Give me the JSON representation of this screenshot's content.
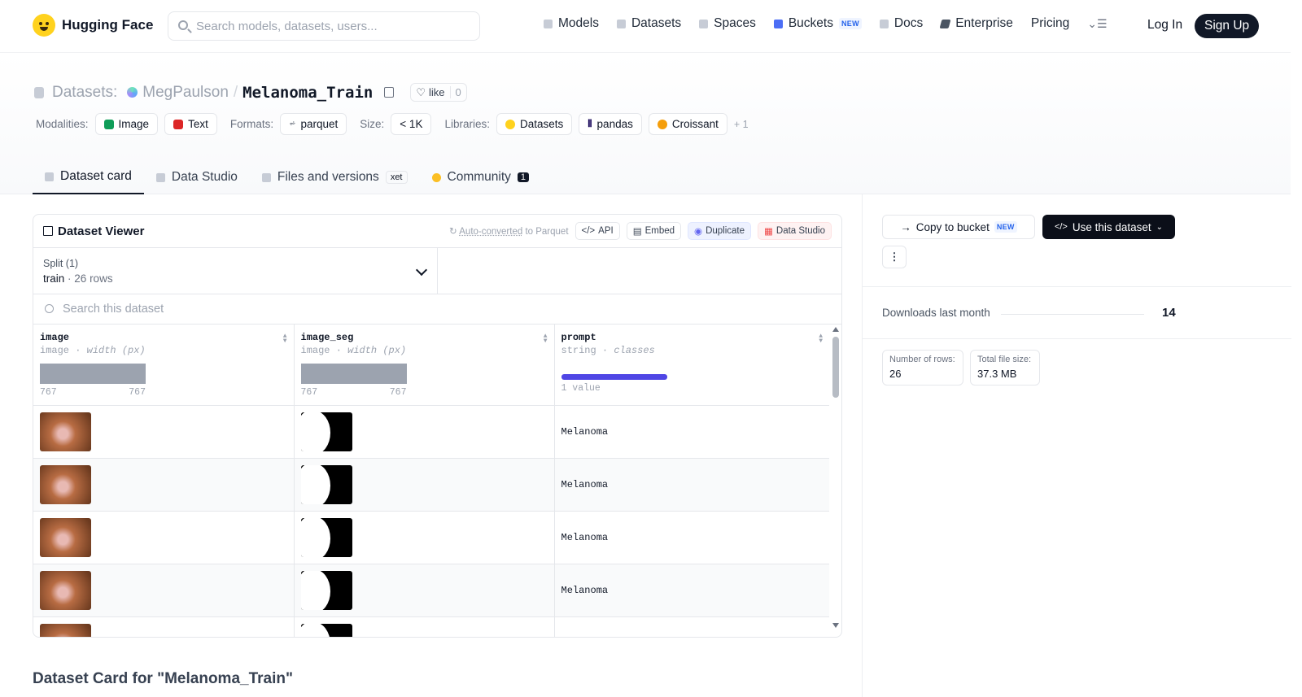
{
  "nav": {
    "brand": "Hugging Face",
    "search_placeholder": "Search models, datasets, users...",
    "links": {
      "models": "Models",
      "datasets": "Datasets",
      "spaces": "Spaces",
      "buckets": "Buckets",
      "buckets_badge": "NEW",
      "docs": "Docs",
      "enterprise": "Enterprise",
      "pricing": "Pricing"
    },
    "login": "Log In",
    "signup": "Sign Up"
  },
  "repo": {
    "section": "Datasets:",
    "owner": "MegPaulson",
    "separator": "/",
    "name": "Melanoma_Train",
    "like_label": "like",
    "like_count": "0"
  },
  "meta": {
    "modalities_label": "Modalities:",
    "modalities": [
      "Image",
      "Text"
    ],
    "formats_label": "Formats:",
    "format": "parquet",
    "size_label": "Size:",
    "size": "< 1K",
    "libraries_label": "Libraries:",
    "libraries": [
      "Datasets",
      "pandas",
      "Croissant"
    ],
    "more": "+ 1"
  },
  "tabs": {
    "card": "Dataset card",
    "studio": "Data Studio",
    "files": "Files and versions",
    "files_badge": "xet",
    "community": "Community",
    "community_count": "1"
  },
  "viewer": {
    "title": "Dataset Viewer",
    "auto_converted": "Auto-converted",
    "to_parquet": " to Parquet",
    "api": "API",
    "embed": "Embed",
    "duplicate": "Duplicate",
    "data_studio": "Data Studio",
    "split_label": "Split (1)",
    "split_value": "train",
    "split_dot": "·",
    "split_rows": "26 rows",
    "search_placeholder": "Search this dataset",
    "columns": [
      {
        "name": "image",
        "type": "image",
        "subtype": "width (px)",
        "min": "767",
        "max": "767"
      },
      {
        "name": "image_seg",
        "type": "image",
        "subtype": "width (px)",
        "min": "767",
        "max": "767"
      },
      {
        "name": "prompt",
        "type": "string",
        "subtype": "classes",
        "stat": "1 value",
        "fill": 1.0
      }
    ],
    "rows": [
      {
        "prompt": "Melanoma"
      },
      {
        "prompt": "Melanoma"
      },
      {
        "prompt": "Melanoma"
      },
      {
        "prompt": "Melanoma"
      },
      {
        "prompt": ""
      }
    ]
  },
  "card_heading": "Dataset Card for \"Melanoma_Train\"",
  "sidebar": {
    "copy_bucket": "Copy to bucket",
    "copy_badge": "NEW",
    "use_dataset": "Use this dataset",
    "more": "⋮",
    "downloads_label": "Downloads last month",
    "downloads_value": "14",
    "rows_label": "Number of rows:",
    "rows_value": "26",
    "size_label": "Total file size:",
    "size_value": "37.3 MB"
  },
  "colors": {
    "accent": "#4f46e5",
    "signup_bg": "#111827",
    "logo": "#ffd21e"
  }
}
